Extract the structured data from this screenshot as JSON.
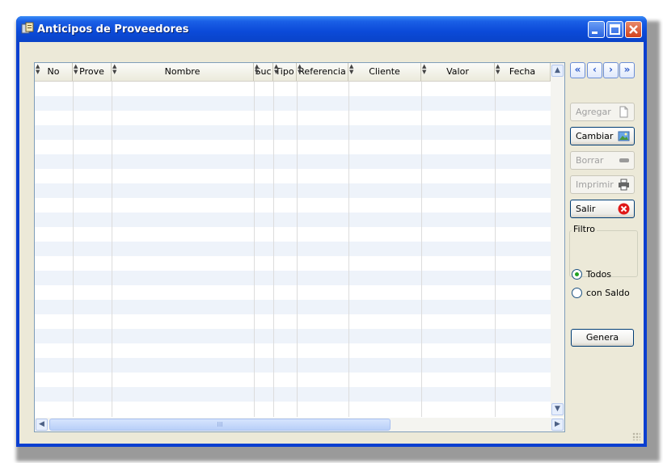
{
  "window": {
    "title": "Anticipos de Proveedores"
  },
  "grid": {
    "columns": [
      "No",
      "Prove",
      "Nombre",
      "Suc",
      "Tipo",
      "Referencia",
      "Cliente",
      "Valor",
      "Fecha"
    ],
    "rows": [],
    "hscroll_thumb": "III"
  },
  "nav": {
    "first": "«",
    "prev": "‹",
    "next": "›",
    "last": "»"
  },
  "actions": {
    "agregar": "Agregar",
    "cambiar": "Cambiar",
    "borrar": "Borrar",
    "imprimir": "Imprimir",
    "salir": "Salir"
  },
  "filtro": {
    "legend": "Filtro",
    "options": [
      "Todos",
      "con Saldo"
    ],
    "selected": "Todos"
  },
  "genera": "Genera",
  "colors": {
    "title_bar": "#0a4ad8",
    "row_alt": "#eef3fa",
    "client_bg": "#ece9d8"
  }
}
